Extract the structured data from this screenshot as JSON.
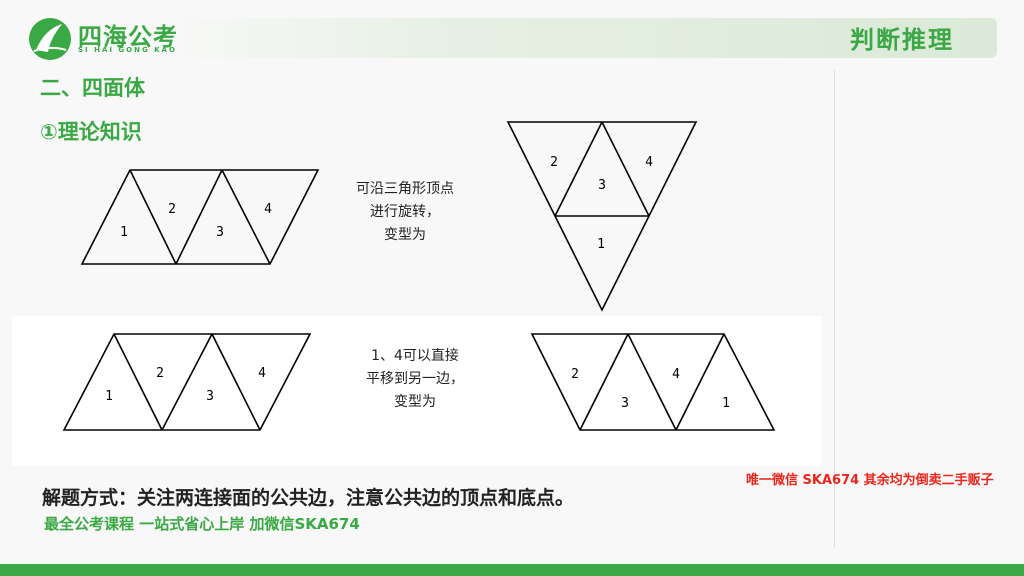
{
  "logo": {
    "cn": "四海公考",
    "en": "SI HAI GONG KAO"
  },
  "badge": "判断推理",
  "section_title": "二、四面体",
  "subsection_title": "①理论知识",
  "diagram1": {
    "left_labels": [
      "1",
      "2",
      "3",
      "4"
    ],
    "right_labels": [
      "2",
      "3",
      "4",
      "1"
    ],
    "note": [
      "可沿三角形顶点",
      "进行旋转，",
      "变型为"
    ]
  },
  "diagram2": {
    "left_labels": [
      "1",
      "2",
      "3",
      "4"
    ],
    "right_labels": [
      "2",
      "3",
      "4",
      "1"
    ],
    "note": [
      "1、4可以直接",
      "平移到另一边，",
      "变型为"
    ]
  },
  "method_text": "解题方式：关注两连接面的公共边，注意公共边的顶点和底点。",
  "promo_text": "最全公考课程 一站式省心上岸 加微信SKA674",
  "watermark": "唯一微信 SKA674 其余均为倒卖二手贩子",
  "colors": {
    "brand_green": "#3aa844",
    "watermark_red": "#e8261e"
  }
}
